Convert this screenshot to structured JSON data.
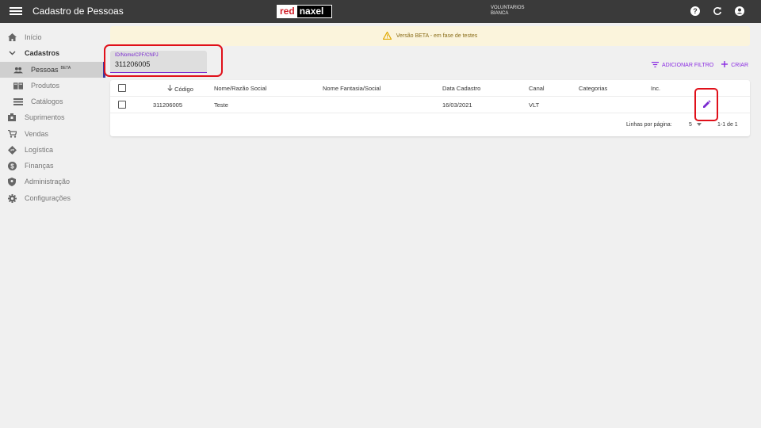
{
  "header": {
    "title": "Cadastro de Pessoas",
    "logo_red": "red",
    "logo_naxel": "naxel",
    "user_line1": "VOLUNTARIOS",
    "user_line2": "BIANCA"
  },
  "sidebar": {
    "items": [
      {
        "label": "Início",
        "icon": "home-icon"
      },
      {
        "label": "Cadastros",
        "icon": "chevron-down-icon"
      },
      {
        "label": "Pessoas",
        "badge": "BETA",
        "icon": "people-icon"
      },
      {
        "label": "Produtos",
        "icon": "book-icon"
      },
      {
        "label": "Catálogos",
        "icon": "list-icon"
      },
      {
        "label": "Suprimentos",
        "icon": "box-icon"
      },
      {
        "label": "Vendas",
        "icon": "cart-icon"
      },
      {
        "label": "Logística",
        "icon": "route-icon"
      },
      {
        "label": "Finanças",
        "icon": "dollar-icon"
      },
      {
        "label": "Administração",
        "icon": "shield-icon"
      },
      {
        "label": "Configurações",
        "icon": "gear-icon"
      }
    ]
  },
  "banner": {
    "text": "Versão BETA - em fase de testes"
  },
  "search": {
    "label": "ID/Nome/CPF/CNPJ",
    "value": "311206005"
  },
  "actions": {
    "add_filter": "ADICIONAR FILTRO",
    "create": "CRIAR"
  },
  "table": {
    "columns": [
      "Código",
      "Nome/Razão Social",
      "Nome Fantasia/Social",
      "Data Cadastro",
      "Canal",
      "Categorias",
      "Inc."
    ],
    "rows": [
      {
        "codigo": "311206005",
        "nome": "Teste",
        "fantasia": "",
        "data": "16/03/2021",
        "canal": "VLT",
        "categorias": "",
        "inc": ""
      }
    ],
    "footer": {
      "rows_per_page_label": "Linhas por página:",
      "rows_per_page": "5",
      "range": "1-1 de 1"
    }
  },
  "colors": {
    "accent": "#7a2ad0",
    "highlight": "#e0101a",
    "topbar": "#3a3a3a"
  }
}
